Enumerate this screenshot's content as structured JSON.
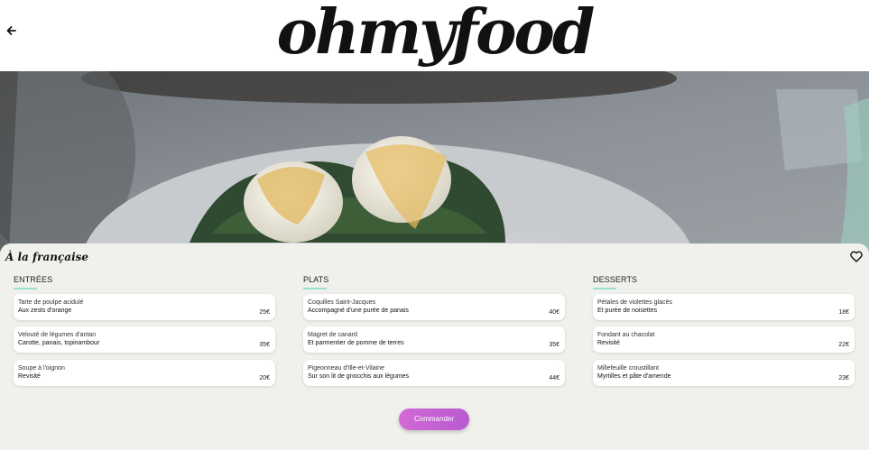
{
  "header": {
    "logo_text": "ohmyfood",
    "back_icon": "arrow-left-icon"
  },
  "hero": {
    "image": "poached-eggs-hollandaise-dish-photo"
  },
  "restaurant": {
    "title": "À la française",
    "favorite_icon": "heart-outline-icon"
  },
  "menu": {
    "columns": [
      {
        "title": "ENTRÉES",
        "items": [
          {
            "name": "Tarte de poulpe acidulé",
            "description": "Aux zests d'orange",
            "price": "25€"
          },
          {
            "name": "Velouté de légumes d'antan",
            "description": "Carotte, panais, topinambour",
            "price": "35€"
          },
          {
            "name": "Soupe à l'oignon",
            "description": "Revisité",
            "price": "20€"
          }
        ]
      },
      {
        "title": "PLATS",
        "items": [
          {
            "name": "Coquilles Saint-Jacques",
            "description": "Accompagné d'une purée de panais",
            "price": "40€"
          },
          {
            "name": "Magret de canard",
            "description": "Et parmentier de pomme de terres",
            "price": "35€"
          },
          {
            "name": "Pigeonneau d'Ille-et-Vilaine",
            "description": "Sur son lit de gnocchis aux légumes",
            "price": "44€"
          }
        ]
      },
      {
        "title": "DESSERTS",
        "items": [
          {
            "name": "Pétales de violettes glacés",
            "description": "Et purée de noisettes",
            "price": "18€"
          },
          {
            "name": "Fondant au chacolat",
            "description": "Revisité",
            "price": "22€"
          },
          {
            "name": "Millefeuille croustillant",
            "description": "Myrtilles et pâte d'amende",
            "price": "23€"
          }
        ]
      }
    ]
  },
  "order_button": {
    "label": "Commander"
  },
  "colors": {
    "accent_underline": "#99e2d0",
    "button_start": "#d269d6",
    "button_end": "#b85ad0"
  }
}
